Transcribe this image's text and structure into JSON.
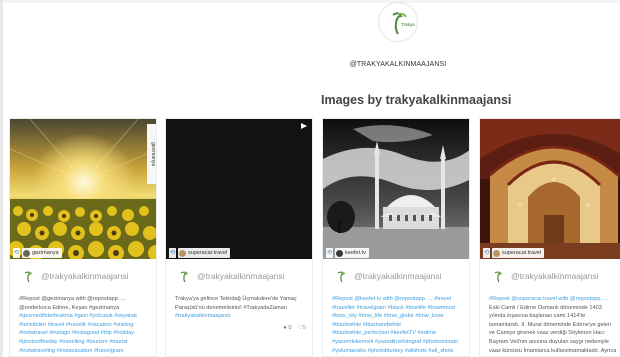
{
  "profile": {
    "avatar_icon": "trakya-logo-icon",
    "avatar_text": "Trakya",
    "handle": "@TRAKYAKALKINMAAJANSI"
  },
  "section": {
    "title": "Images by trakyakalkinmaajansi"
  },
  "cards": [
    {
      "source": "gezimanya",
      "side_handle": "gezimanya",
      "author": "@trakyakalkinmaajansi",
      "caption_lines": [
        "#Repost @gezimanya with @repostapp. ...",
        "@onderkoca Edirne, Keşan #gezimanya",
        "#gezmedifsterbrakma #gezi #yolculuk #seyahat",
        "#turistbilen #travel #traveltr #vacation #visiting",
        "#instatravel #instago #instagood #trip #holiday",
        "#photooftheday #travelling #tourism #tourist",
        "#instatraveling #instavacation #travelgram"
      ]
    },
    {
      "source": "superacar.travel",
      "author": "@trakyakalkinmaajansi",
      "caption_lines": [
        "Trakya'ya gelince Tekirdağ Üçmakdere'de Yamaç",
        "Paraşütü'nü denemelisiniz! #TrakyadaZaman",
        "#trakyakalkinmaajansi"
      ],
      "comments": "0",
      "likes": "5"
    },
    {
      "source": "keefet.tv",
      "author": "@trakyakalkinmaajansi",
      "caption_lines": [
        "#Repost @keefet.tv with @repostapp. ... #travel",
        "#traveller #travelgram #black #bnwlife #bnwmood",
        "#bnw_city #bnw_life #bnw_globe #bnw_lover",
        "#blackwhite #blackandwhite",
        "#blackwhite_perfection #keefetTV #edirne",
        "#yasemkikemsrli #yasedirnefotograf #photooninato",
        "#yolumaesiko #photobturkey #allshots #all_shots"
      ]
    },
    {
      "source": "superacar.travel",
      "author": "@trakyakalkinmaajansi",
      "caption_lines": [
        "#Repost @superacar.travel with @repostapp. ...",
        "Eski Camii / Edirne Osmanlı döneminde 1403",
        "yılında inşasına başlanan cami 1414'te",
        "tamamlandı. II. Murat döneminde Edirne'ye gelen",
        "ve Camiye girenek vaaz verdiği Söylenen Hacı",
        "Bayram Veli'nin anısına duyulan saygı nedeniyle",
        "vaaz kürsüsü İmamlarca kullanılmamaktadır. Ayrıca"
      ]
    }
  ],
  "icons": {
    "repost": "repost-icon",
    "play": "play-icon",
    "comment": "comment-icon",
    "like": "heart-icon",
    "multi": "gallery-icon"
  },
  "colors": {
    "hashtag": "#3d9ee0",
    "author": "#999999",
    "like": "#e57373"
  }
}
